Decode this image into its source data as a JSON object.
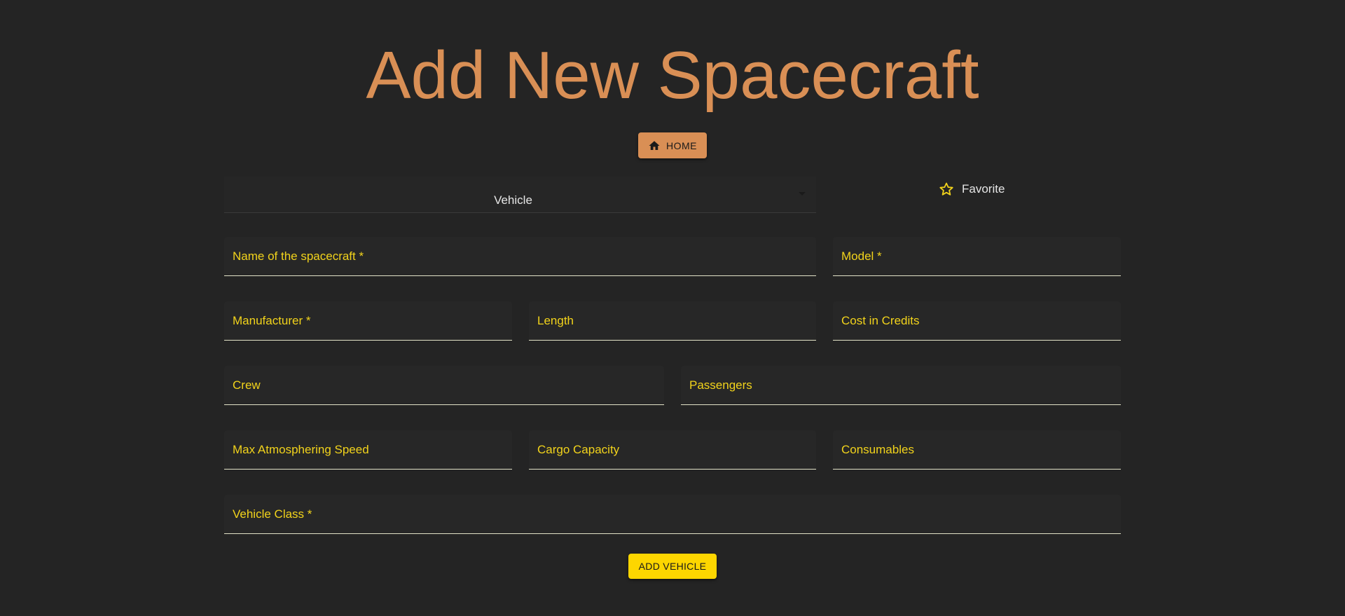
{
  "page": {
    "title": "Add New Spacecraft"
  },
  "nav": {
    "home_label": "HOME",
    "home_icon": "home-icon"
  },
  "type_select": {
    "value": "Vehicle"
  },
  "favorite": {
    "label": "Favorite",
    "icon": "star-outline-icon",
    "color": "#f2d31b"
  },
  "form": {
    "name_label": "Name of the spacecraft *",
    "model_label": "Model *",
    "manufacturer_label": "Manufacturer *",
    "length_label": "Length",
    "cost_label": "Cost in Credits",
    "crew_label": "Crew",
    "passengers_label": "Passengers",
    "max_speed_label": "Max Atmosphering Speed",
    "cargo_label": "Cargo Capacity",
    "consumables_label": "Consumables",
    "vehicle_class_label": "Vehicle Class *",
    "submit_label": "ADD VEHICLE"
  },
  "colors": {
    "background": "#242424",
    "accent": "#d98f55",
    "label": "#f2d31b",
    "submit": "#fdd600"
  }
}
